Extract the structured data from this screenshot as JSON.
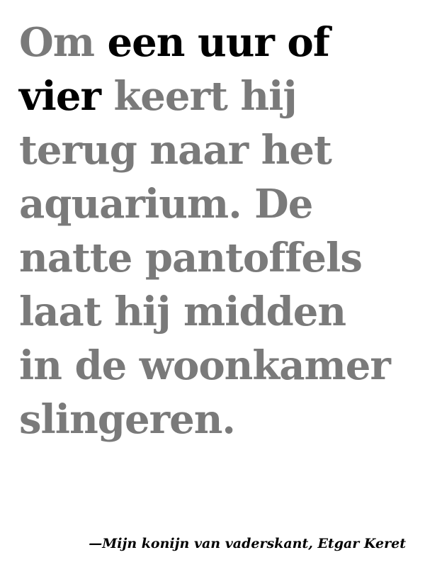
{
  "quote": {
    "lines": [
      [
        {
          "text": "Om ",
          "highlight": false
        },
        {
          "text": "een uur of",
          "highlight": true
        }
      ],
      [
        {
          "text": "vier",
          "highlight": true
        },
        {
          "text": " keert hij",
          "highlight": false
        }
      ],
      [
        {
          "text": "terug naar het",
          "highlight": false
        }
      ],
      [
        {
          "text": "aquarium. De",
          "highlight": false
        }
      ],
      [
        {
          "text": "natte pantoffels",
          "highlight": false
        }
      ],
      [
        {
          "text": "laat hij midden",
          "highlight": false
        }
      ],
      [
        {
          "text": "in de woonkamer",
          "highlight": false
        }
      ],
      [
        {
          "text": "slingeren.",
          "highlight": false
        }
      ]
    ]
  },
  "attribution": "—Mijn konijn van vaderskant, Etgar Keret",
  "colors": {
    "text_muted": "#7a7a7a",
    "text_highlight": "#000000",
    "background": "#ffffff"
  }
}
